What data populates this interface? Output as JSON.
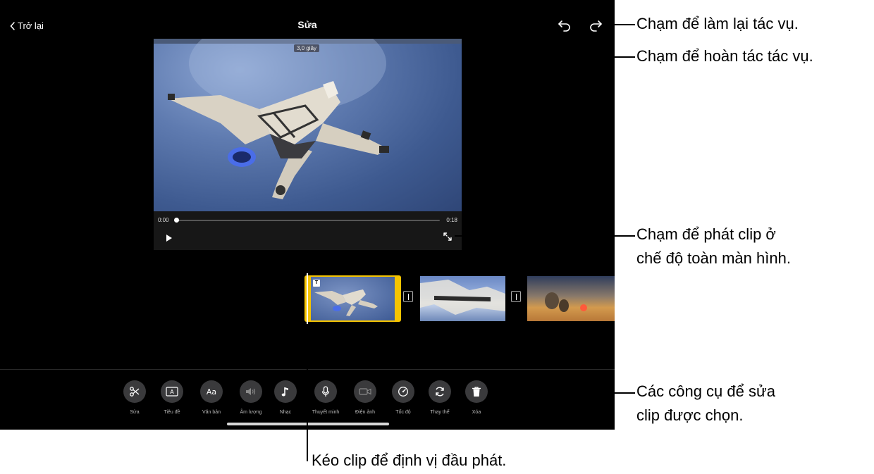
{
  "app": {
    "back_label": "Trở lại",
    "title": "Sửa"
  },
  "viewer": {
    "duration_badge": "3,0 giây",
    "current_time": "0:00",
    "end_time": "0:18",
    "progress": 0
  },
  "tools": [
    {
      "label": "Sửa",
      "icon": "scissors-icon"
    },
    {
      "label": "Tiêu đề",
      "icon": "title-icon"
    },
    {
      "label": "Văn bản",
      "icon": "text-icon"
    },
    {
      "label": "Âm lượng",
      "icon": "volume-icon"
    },
    {
      "label": "Nhạc",
      "icon": "music-note-icon"
    },
    {
      "label": "Thuyết minh",
      "icon": "microphone-icon"
    },
    {
      "label": "Điện ảnh",
      "icon": "video-camera-icon"
    },
    {
      "label": "Tốc độ",
      "icon": "speedometer-icon"
    },
    {
      "label": "Thay thế",
      "icon": "replace-icon"
    },
    {
      "label": "Xóa",
      "icon": "trash-icon"
    }
  ],
  "callouts": {
    "redo": "Chạm để làm lại tác vụ.",
    "undo": "Chạm để hoàn tác tác vụ.",
    "fullscreen_line1": "Chạm để phát clip ở",
    "fullscreen_line2": "chế độ toàn màn hình.",
    "tools_line1": "Các công cụ để sửa",
    "tools_line2": "clip được chọn.",
    "playhead": "Kéo clip để định vị đầu phát."
  },
  "colors": {
    "selected_clip": "#f5c400",
    "background": "#000000",
    "tool_circle": "#3a3a3c"
  }
}
